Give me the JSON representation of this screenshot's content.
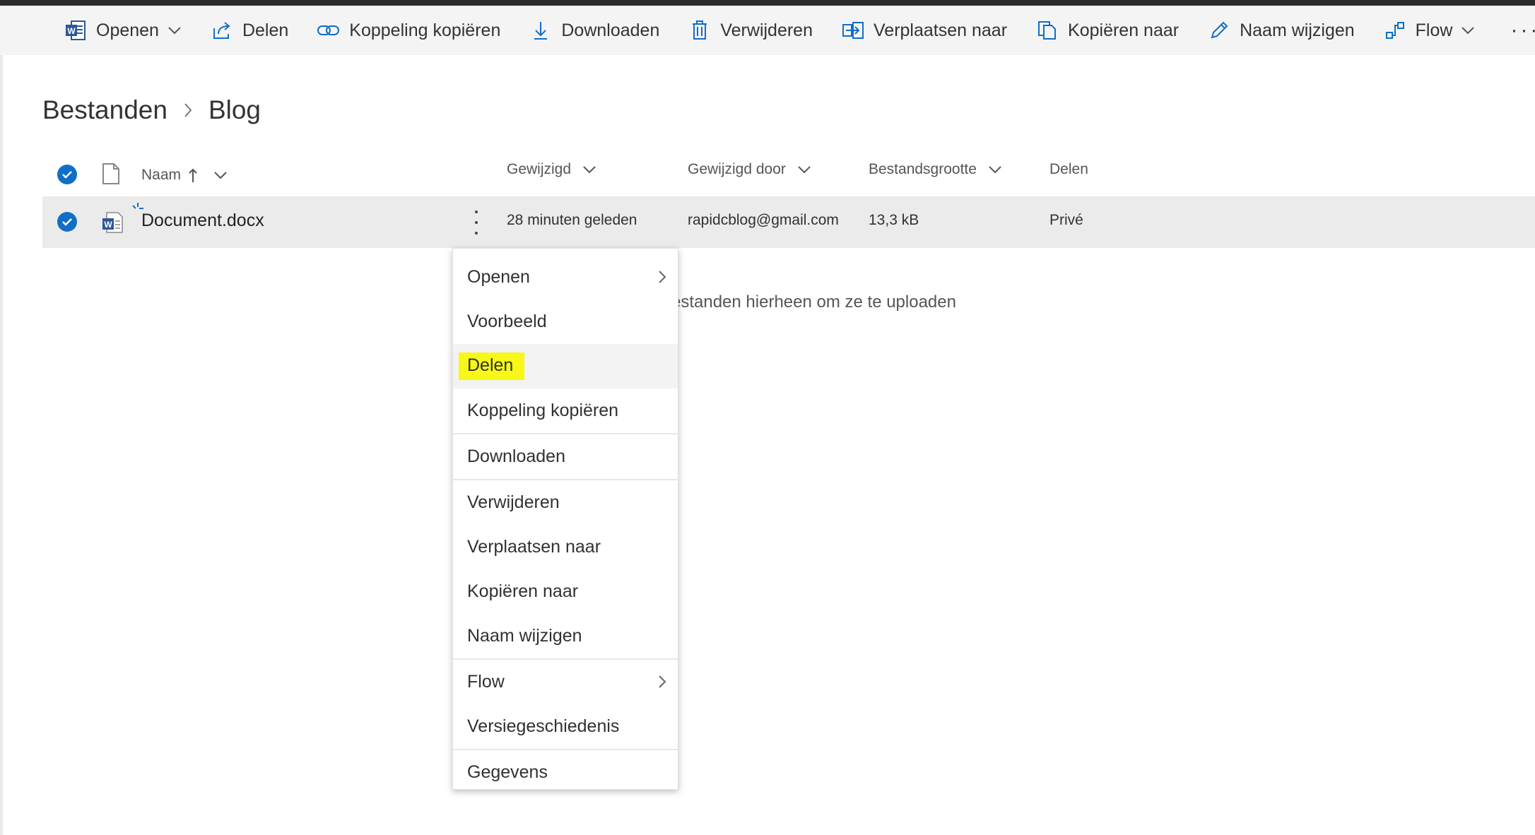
{
  "toolbar": {
    "items": [
      {
        "label": "Openen",
        "icon": "word-icon",
        "has_dropdown": true
      },
      {
        "label": "Delen",
        "icon": "share-icon"
      },
      {
        "label": "Koppeling kopiëren",
        "icon": "link-icon"
      },
      {
        "label": "Downloaden",
        "icon": "download-icon"
      },
      {
        "label": "Verwijderen",
        "icon": "trash-icon"
      },
      {
        "label": "Verplaatsen naar",
        "icon": "move-icon"
      },
      {
        "label": "Kopiëren naar",
        "icon": "copy-icon"
      },
      {
        "label": "Naam wijzigen",
        "icon": "pencil-icon"
      },
      {
        "label": "Flow",
        "icon": "flow-icon",
        "has_dropdown": true
      }
    ],
    "more": "···"
  },
  "breadcrumb": {
    "root": "Bestanden",
    "current": "Blog"
  },
  "columns": {
    "name": "Naam",
    "modified": "Gewijzigd",
    "modified_by": "Gewijzigd door",
    "size": "Bestandsgrootte",
    "sharing": "Delen"
  },
  "files": [
    {
      "name": "Document.docx",
      "modified": "28 minuten geleden",
      "modified_by": "rapidcblog@gmail.com",
      "size": "13,3 kB",
      "sharing": "Privé"
    }
  ],
  "drop_message": "estanden hierheen om ze te uploaden",
  "context_menu": {
    "openen": "Openen",
    "voorbeeld": "Voorbeeld",
    "delen": "Delen",
    "koppeling": "Koppeling kopiëren",
    "downloaden": "Downloaden",
    "verwijderen": "Verwijderen",
    "verplaatsen": "Verplaatsen naar",
    "kopieren": "Kopiëren naar",
    "naam": "Naam wijzigen",
    "flow": "Flow",
    "versie": "Versiegeschiedenis",
    "gegevens": "Gegevens"
  },
  "colors": {
    "accent": "#0f6fc6",
    "highlight": "#f7f718",
    "word_blue": "#2b579a"
  }
}
